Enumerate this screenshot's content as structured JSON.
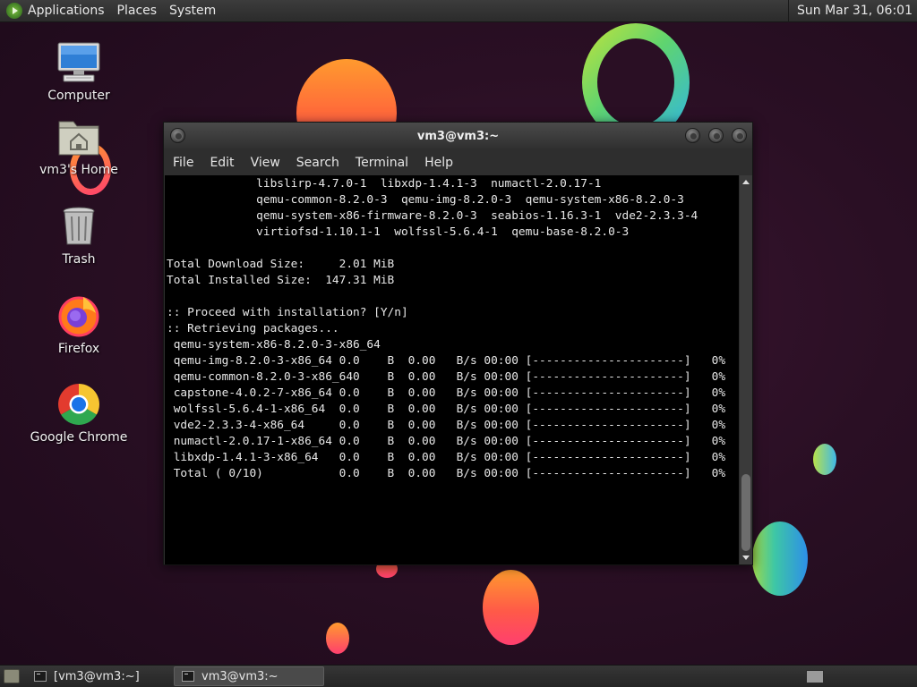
{
  "top_panel": {
    "menus": [
      "Applications",
      "Places",
      "System"
    ],
    "clock": "Sun Mar 31, 06:01"
  },
  "desktop_icons": [
    {
      "label": "Computer",
      "icon": "computer-icon"
    },
    {
      "label": "vm3's Home",
      "icon": "home-folder-icon"
    },
    {
      "label": "Trash",
      "icon": "trash-icon"
    },
    {
      "label": "Firefox",
      "icon": "firefox-icon"
    },
    {
      "label": "Google Chrome",
      "icon": "chrome-icon"
    }
  ],
  "terminal": {
    "title": "vm3@vm3:~",
    "menus": [
      "File",
      "Edit",
      "View",
      "Search",
      "Terminal",
      "Help"
    ],
    "lines": [
      "             libslirp-4.7.0-1  libxdp-1.4.1-3  numactl-2.0.17-1",
      "             qemu-common-8.2.0-3  qemu-img-8.2.0-3  qemu-system-x86-8.2.0-3",
      "             qemu-system-x86-firmware-8.2.0-3  seabios-1.16.3-1  vde2-2.3.3-4",
      "             virtiofsd-1.10.1-1  wolfssl-5.6.4-1  qemu-base-8.2.0-3",
      "",
      "Total Download Size:     2.01 MiB",
      "Total Installed Size:  147.31 MiB",
      "",
      ":: Proceed with installation? [Y/n]",
      ":: Retrieving packages...",
      " qemu-system-x86-8.2.0-3-x86_64",
      " qemu-img-8.2.0-3-x86_64 0.0    B  0.00   B/s 00:00 [----------------------]   0%",
      " qemu-common-8.2.0-3-x86_640    B  0.00   B/s 00:00 [----------------------]   0%",
      " capstone-4.0.2-7-x86_64 0.0    B  0.00   B/s 00:00 [----------------------]   0%",
      " wolfssl-5.6.4-1-x86_64  0.0    B  0.00   B/s 00:00 [----------------------]   0%",
      " vde2-2.3.3-4-x86_64     0.0    B  0.00   B/s 00:00 [----------------------]   0%",
      " numactl-2.0.17-1-x86_64 0.0    B  0.00   B/s 00:00 [----------------------]   0%",
      " libxdp-1.4.1-3-x86_64   0.0    B  0.00   B/s 00:00 [----------------------]   0%",
      " Total ( 0/10)           0.0    B  0.00   B/s 00:00 [----------------------]   0%"
    ]
  },
  "taskbar": {
    "tasks": [
      {
        "label": "[vm3@vm3:~]",
        "active": false
      },
      {
        "label": "vm3@vm3:~",
        "active": true
      }
    ]
  }
}
